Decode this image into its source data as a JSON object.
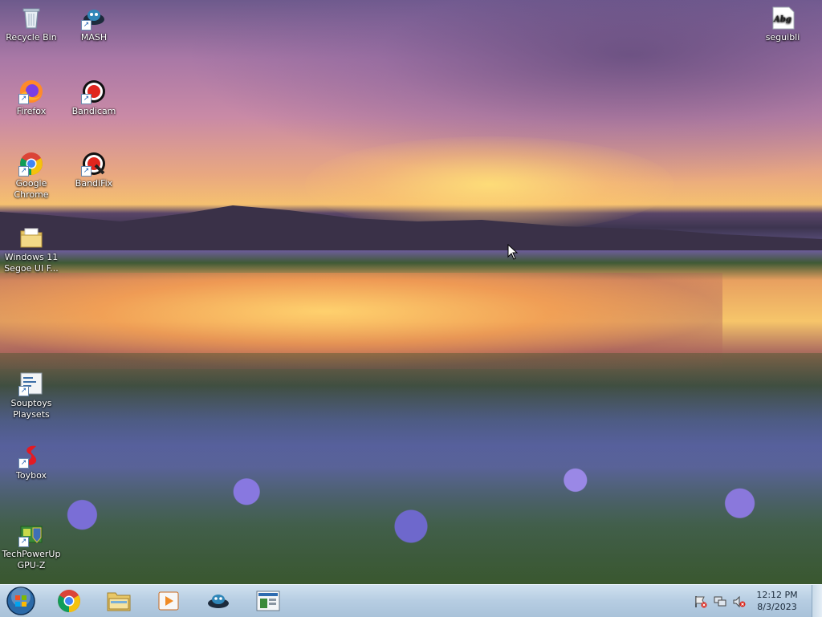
{
  "desktop": {
    "icons": [
      {
        "id": "recycle-bin",
        "label": "Recycle Bin"
      },
      {
        "id": "mash",
        "label": "MASH"
      },
      {
        "id": "seguibli",
        "label": "seguibli"
      },
      {
        "id": "firefox",
        "label": "Firefox"
      },
      {
        "id": "bandicam",
        "label": "Bandicam"
      },
      {
        "id": "google-chrome",
        "label": "Google Chrome"
      },
      {
        "id": "bandifix",
        "label": "BandiFix"
      },
      {
        "id": "windows11-segoe",
        "label": "Windows 11 Segoe UI F..."
      },
      {
        "id": "souptoys",
        "label": "Souptoys Playsets"
      },
      {
        "id": "toybox",
        "label": "Toybox"
      },
      {
        "id": "gpu-z",
        "label": "TechPowerUp GPU-Z"
      }
    ],
    "seguibli_glyph": "Abg"
  },
  "taskbar": {
    "pinned": [
      "start-orb",
      "chrome",
      "file-explorer",
      "media-player",
      "mash",
      "control-panel"
    ],
    "tray_icons": [
      "action-center-flag-icon",
      "network-icon",
      "volume-muted-icon"
    ],
    "clock_time": "12:12 PM",
    "clock_date": "8/3/2023"
  }
}
